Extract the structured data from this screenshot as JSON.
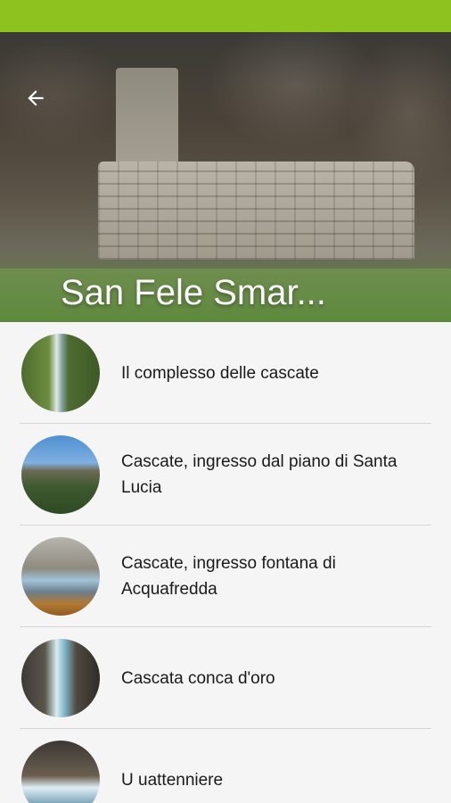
{
  "colors": {
    "status_bar": "#8dc21f",
    "list_background": "#f5f5f5",
    "divider": "#d6d6d6",
    "title_text": "#ffffff",
    "item_text": "#1a1a1a"
  },
  "header": {
    "title": "San Fele Smar...",
    "back_icon": "arrow-left-icon"
  },
  "items": [
    {
      "label": "Il complesso delle cascate"
    },
    {
      "label": "Cascate, ingresso dal piano di Santa Lucia"
    },
    {
      "label": "Cascate, ingresso fontana di Acquafredda"
    },
    {
      "label": "Cascata conca d'oro"
    },
    {
      "label": "U uattenniere"
    }
  ]
}
